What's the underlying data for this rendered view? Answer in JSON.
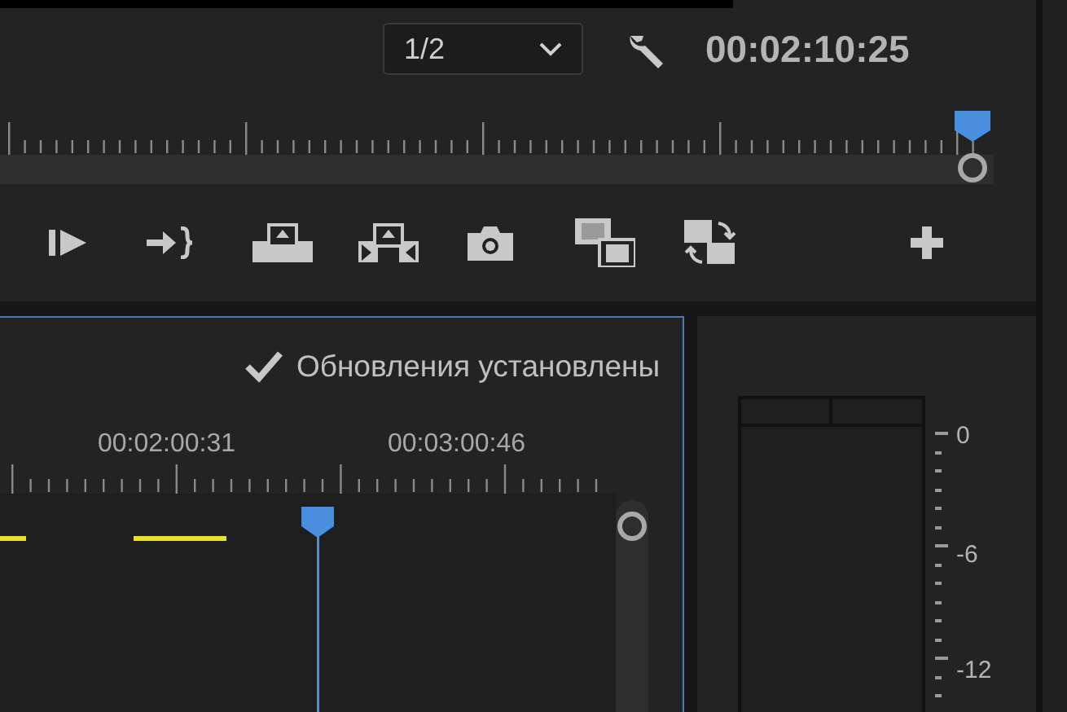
{
  "program_monitor": {
    "resolution": "1/2",
    "timecode": "00:02:10:25"
  },
  "timeline": {
    "status": "Обновления установлены",
    "ruler_labels": [
      "00:02:00:31",
      "00:03:00:46"
    ]
  },
  "audio_meter": {
    "scale": [
      "0",
      "-6",
      "-12"
    ]
  }
}
